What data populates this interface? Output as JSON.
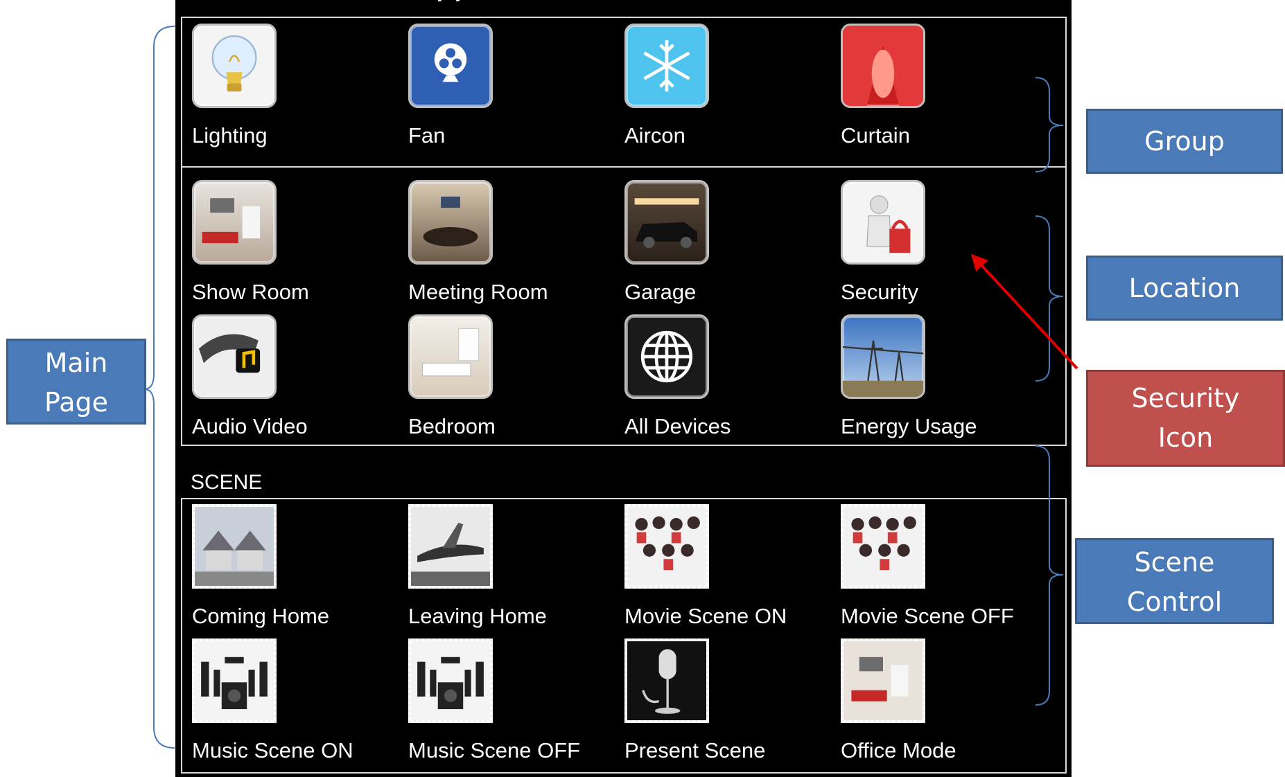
{
  "screen": {
    "top_fragment": "/  /",
    "groups": [
      {
        "label": "Lighting",
        "icon": "light-bulb-icon"
      },
      {
        "label": "Fan",
        "icon": "fan-icon"
      },
      {
        "label": "Aircon",
        "icon": "snowflake-icon"
      },
      {
        "label": "Curtain",
        "icon": "curtain-icon"
      }
    ],
    "locations": [
      {
        "label": "Show Room",
        "icon": "show-room-photo-icon"
      },
      {
        "label": "Meeting Room",
        "icon": "meeting-room-photo-icon"
      },
      {
        "label": "Garage",
        "icon": "garage-car-photo-icon"
      },
      {
        "label": "Security",
        "icon": "security-figure-icon"
      },
      {
        "label": "Audio Video",
        "icon": "film-reel-music-icon"
      },
      {
        "label": "Bedroom",
        "icon": "bedroom-photo-icon"
      },
      {
        "label": "All Devices",
        "icon": "globe-icon"
      },
      {
        "label": "Energy Usage",
        "icon": "power-lines-icon"
      }
    ],
    "scene_heading": "SCENE",
    "scenes": [
      {
        "label": "Coming Home",
        "icon": "houses-photo-icon"
      },
      {
        "label": "Leaving Home",
        "icon": "airplane-photo-icon"
      },
      {
        "label": "Movie Scene ON",
        "icon": "group-photo-icon"
      },
      {
        "label": "Movie Scene OFF",
        "icon": "group-photo-icon"
      },
      {
        "label": "Music Scene ON",
        "icon": "speakers-icon"
      },
      {
        "label": "Music Scene OFF",
        "icon": "speakers-icon"
      },
      {
        "label": "Present Scene",
        "icon": "microphone-icon"
      },
      {
        "label": "Office Mode",
        "icon": "room-photo-icon"
      }
    ]
  },
  "annotations": {
    "main_page": "Main Page",
    "group": "Group",
    "location": "Location",
    "security_icon": "Security Icon",
    "scene_control": "Scene Control"
  },
  "colors": {
    "annotation_blue": "#4a7ab8",
    "annotation_red": "#c0504d",
    "arrow": "#e00000",
    "bracket": "#4a7ab8"
  }
}
